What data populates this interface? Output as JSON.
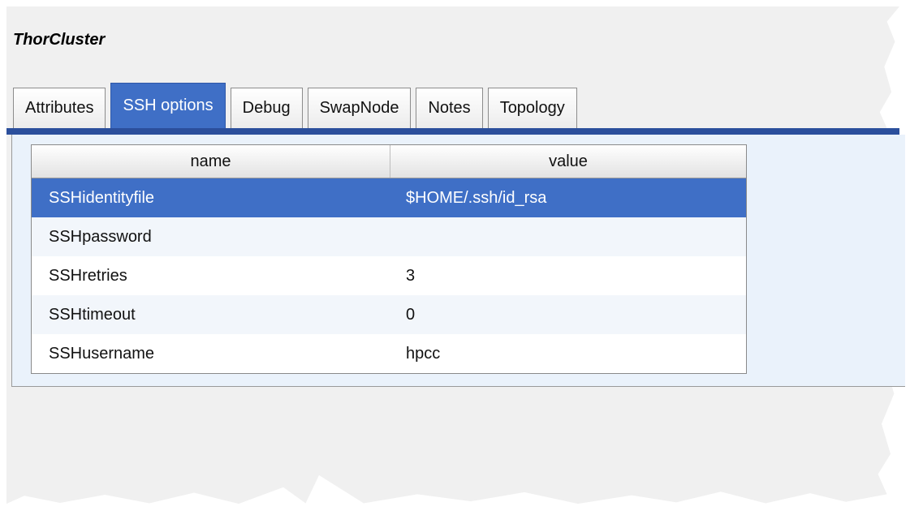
{
  "window": {
    "title": "ThorCluster"
  },
  "tabs": [
    {
      "label": "Attributes",
      "active": false
    },
    {
      "label": "SSH options",
      "active": true
    },
    {
      "label": "Debug",
      "active": false
    },
    {
      "label": "SwapNode",
      "active": false
    },
    {
      "label": "Notes",
      "active": false
    },
    {
      "label": "Topology",
      "active": false
    }
  ],
  "table": {
    "columns": [
      "name",
      "value"
    ],
    "rows": [
      {
        "name": "SSHidentityfile",
        "value": "$HOME/.ssh/id_rsa",
        "selected": true
      },
      {
        "name": "SSHpassword",
        "value": "",
        "selected": false
      },
      {
        "name": "SSHretries",
        "value": "3",
        "selected": false
      },
      {
        "name": "SSHtimeout",
        "value": "0",
        "selected": false
      },
      {
        "name": "SSHusername",
        "value": "hpcc",
        "selected": false
      }
    ]
  },
  "colors": {
    "accent": "#3f6fc6",
    "tab_bar": "#2b4f9c",
    "panel_background": "#eaf2fb"
  }
}
